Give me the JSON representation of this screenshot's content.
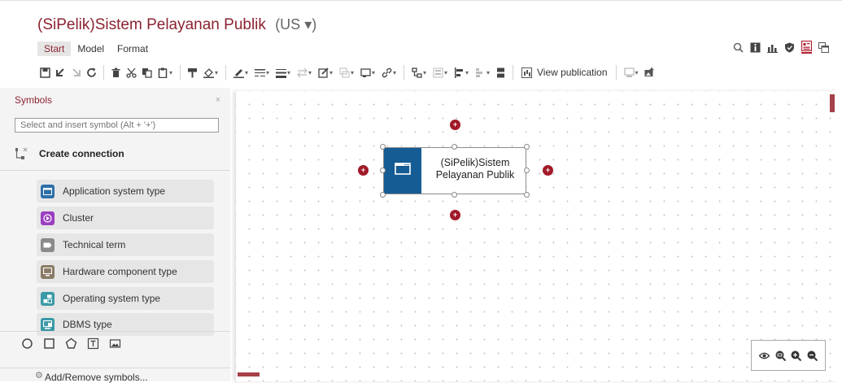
{
  "app": {
    "title": "(SiPelik)Sistem Pelayanan Publik",
    "language": "(US ▾)"
  },
  "tabs": [
    {
      "label": "Start",
      "active": true
    },
    {
      "label": "Model",
      "active": false
    },
    {
      "label": "Format",
      "active": false
    }
  ],
  "top_icons": [
    "search-icon",
    "info-icon",
    "chart-icon",
    "shield-icon",
    "properties-icon",
    "windows-icon"
  ],
  "toolbar": {
    "view_publication_label": "View publication"
  },
  "sidebar": {
    "header": "Symbols",
    "close": "×",
    "search_placeholder": "Select and insert symbol (Alt + '+')",
    "create_connection": "Create connection",
    "items": [
      {
        "label": "Application system type",
        "color": "#2d6fa8",
        "icon": "window-icon"
      },
      {
        "label": "Cluster",
        "color": "#9b3fc0",
        "icon": "cluster-icon"
      },
      {
        "label": "Technical term",
        "color": "#8a8a8a",
        "icon": "term-icon"
      },
      {
        "label": "Hardware component type",
        "color": "#8b7b66",
        "icon": "monitor-icon"
      },
      {
        "label": "Operating system type",
        "color": "#3a9aa6",
        "icon": "os-icon"
      },
      {
        "label": "DBMS type",
        "color": "#3a9aa6",
        "icon": "dbms-icon"
      }
    ],
    "shapes": [
      "circle-icon",
      "square-icon",
      "pentagon-icon",
      "text-frame-icon",
      "image-icon"
    ],
    "add_remove": "Add/Remove symbols..."
  },
  "canvas": {
    "node": {
      "line1": "(SiPelik)Sistem",
      "line2": "Pelayanan Publik",
      "color": "#165c94"
    }
  },
  "colors": {
    "brand": "#8b2330",
    "accent": "#a11a28"
  }
}
